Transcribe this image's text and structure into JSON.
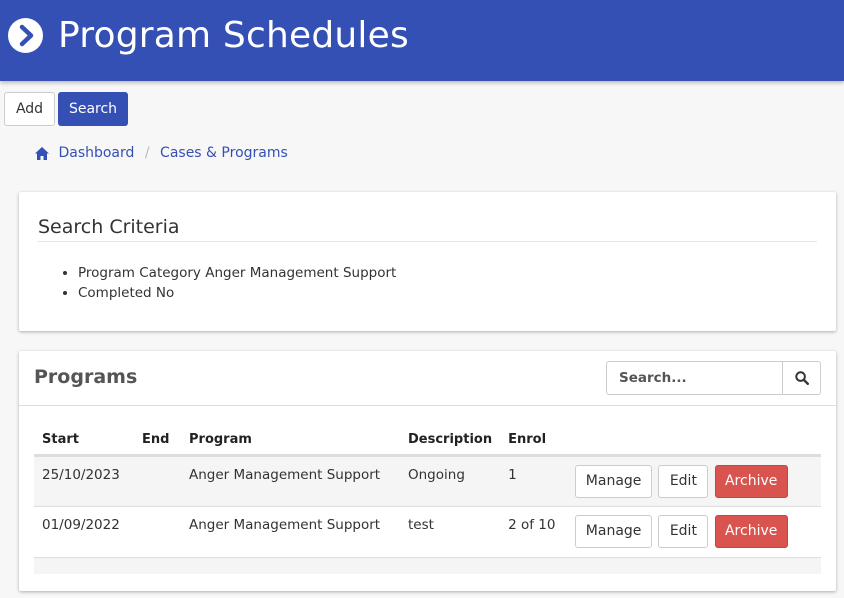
{
  "header": {
    "title": "Program Schedules",
    "icon": "chevron-right-circle-icon",
    "bg_color": "#3550b5"
  },
  "toolbar": {
    "add_label": "Add",
    "search_label": "Search"
  },
  "breadcrumb": {
    "home_icon": "home-icon",
    "items": [
      "Dashboard",
      "Cases & Programs"
    ]
  },
  "criteria": {
    "title": "Search Criteria",
    "items": [
      "Program Category Anger Management Support",
      "Completed No"
    ]
  },
  "programs": {
    "title": "Programs",
    "search_placeholder": "Search...",
    "columns": [
      "Start",
      "End",
      "Program",
      "Description",
      "Enrol"
    ],
    "rows": [
      {
        "start": "25/10/2023",
        "end": "",
        "program": "Anger Management Support",
        "description": "Ongoing",
        "enrol": "1"
      },
      {
        "start": "01/09/2022",
        "end": "",
        "program": "Anger Management Support",
        "description": "test",
        "enrol": "2 of 10"
      }
    ],
    "actions": {
      "manage": "Manage",
      "edit": "Edit",
      "archive": "Archive"
    },
    "archive_color": "#d9534f"
  }
}
